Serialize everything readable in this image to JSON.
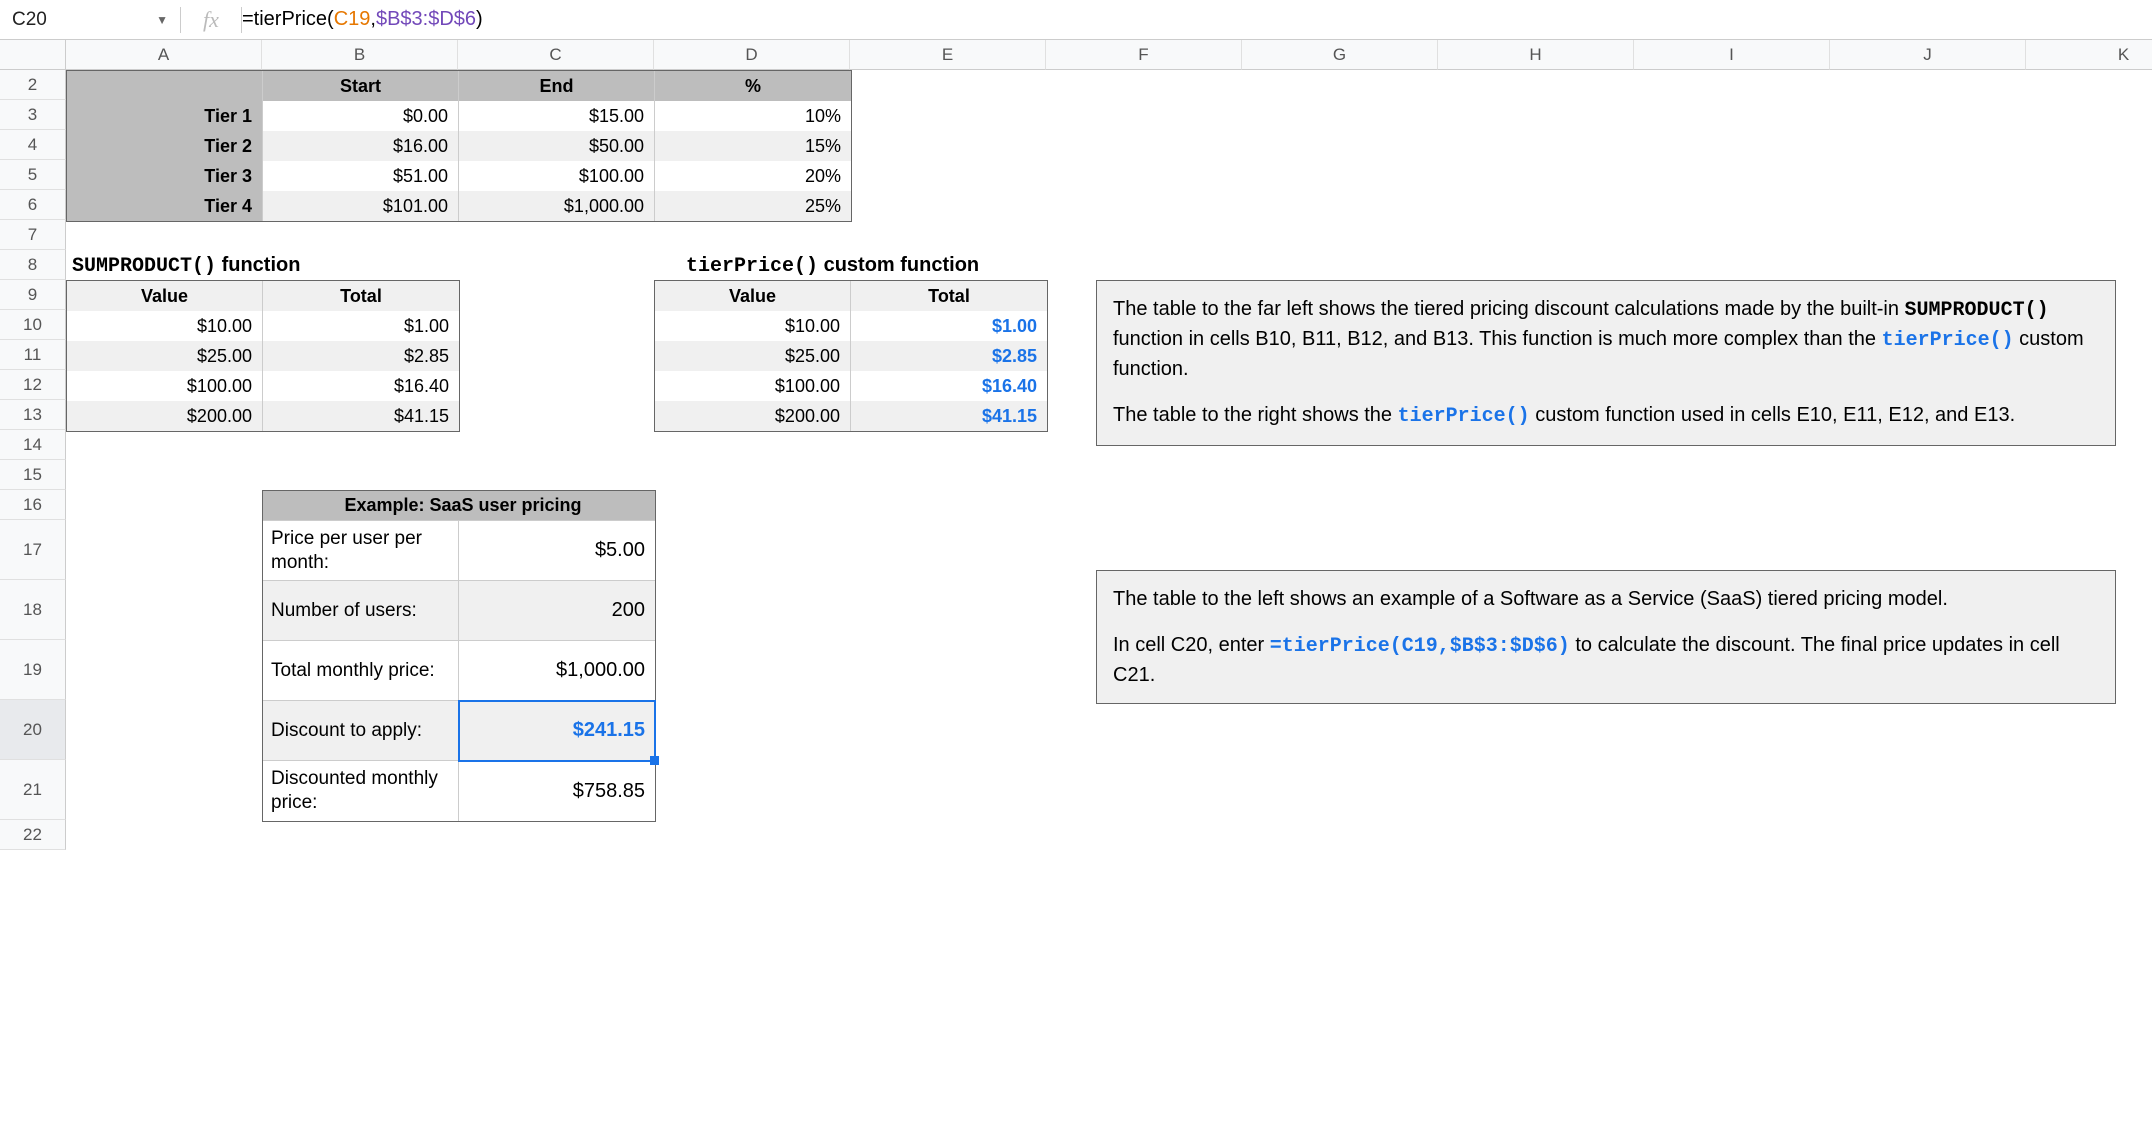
{
  "nameBox": "C20",
  "formula": {
    "prefix": "=tierPrice(",
    "arg1": "C19",
    "comma": ",",
    "arg2": "$B$3:$D$6",
    "suffix": ")"
  },
  "columns": [
    "A",
    "B",
    "C",
    "D",
    "E",
    "F",
    "G",
    "H",
    "I",
    "J",
    "K"
  ],
  "rowNumbers": [
    "2",
    "3",
    "4",
    "5",
    "6",
    "7",
    "8",
    "9",
    "10",
    "11",
    "12",
    "13",
    "14",
    "15",
    "16",
    "17",
    "18",
    "19",
    "20",
    "21",
    "22"
  ],
  "tierTable": {
    "headers": [
      "",
      "Start",
      "End",
      "%"
    ],
    "rows": [
      {
        "label": "Tier 1",
        "start": "$0.00",
        "end": "$15.00",
        "pct": "10%"
      },
      {
        "label": "Tier 2",
        "start": "$16.00",
        "end": "$50.00",
        "pct": "15%"
      },
      {
        "label": "Tier 3",
        "start": "$51.00",
        "end": "$100.00",
        "pct": "20%"
      },
      {
        "label": "Tier 4",
        "start": "$101.00",
        "end": "$1,000.00",
        "pct": "25%"
      }
    ]
  },
  "headings": {
    "sumproduct_mono": "SUMPRODUCT()",
    "sumproduct_rest": " function",
    "tierprice_mono": "tierPrice()",
    "tierprice_rest": " custom function"
  },
  "valTables": {
    "headers": [
      "Value",
      "Total"
    ],
    "sum": [
      {
        "v": "$10.00",
        "t": "$1.00"
      },
      {
        "v": "$25.00",
        "t": "$2.85"
      },
      {
        "v": "$100.00",
        "t": "$16.40"
      },
      {
        "v": "$200.00",
        "t": "$41.15"
      }
    ],
    "tier": [
      {
        "v": "$10.00",
        "t": "$1.00"
      },
      {
        "v": "$25.00",
        "t": "$2.85"
      },
      {
        "v": "$100.00",
        "t": "$16.40"
      },
      {
        "v": "$200.00",
        "t": "$41.15"
      }
    ]
  },
  "saas": {
    "title": "Example: SaaS user pricing",
    "rows": [
      {
        "label": "Price per user per month:",
        "val": "$5.00"
      },
      {
        "label": "Number of users:",
        "val": "200"
      },
      {
        "label": "Total monthly price:",
        "val": "$1,000.00"
      },
      {
        "label": "Discount to apply:",
        "val": "$241.15"
      },
      {
        "label": "Discounted monthly price:",
        "val": "$758.85"
      }
    ]
  },
  "info1": {
    "p1a": "The table to the far left shows the tiered pricing discount calculations made by the built-in ",
    "p1b": "SUMPRODUCT()",
    "p1c": " function in cells B10, B11, B12, and B13. This function is much more complex than the ",
    "p1d": "tierPrice()",
    "p1e": " custom function.",
    "p2a": "The table to the right shows the ",
    "p2b": "tierPrice()",
    "p2c": " custom function used in cells E10, E11, E12, and E13."
  },
  "info2": {
    "p1": "The table to the left shows an example of a Software as a Service (SaaS) tiered pricing model.",
    "p2a": "In cell C20, enter ",
    "p2b": "=tierPrice(C19,$B$3:$D$6)",
    "p2c": " to calculate the discount. The final price updates in cell C21."
  }
}
